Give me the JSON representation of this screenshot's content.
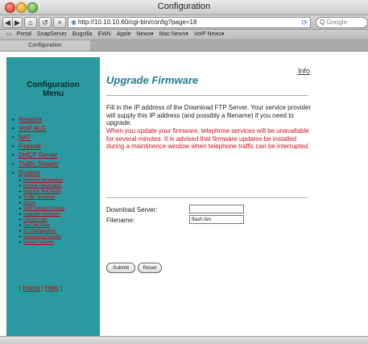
{
  "window": {
    "title": "Configuration"
  },
  "toolbar": {
    "back": "◀",
    "forward": "▶",
    "home": "⌂",
    "reload": "↺",
    "add": "+",
    "url": "http://10.10.10.60/cgi-bin/config?page=18",
    "search_placeholder": "Google"
  },
  "bookmarks": [
    "Portal",
    "SnapServer",
    "Bugzilla",
    "EWN",
    "Apple",
    "News▾",
    "Mac News▾",
    "VoIP News▾"
  ],
  "tab": {
    "label": "Configuration"
  },
  "sidebar": {
    "title_line1": "Configuration",
    "title_line2": "Menu",
    "items": [
      "Network",
      "VoIP ALG",
      "NAT",
      "Firewall",
      "DHCP Server",
      "Traffic Shaper",
      "System"
    ],
    "subitems": [
      "Network Information",
      "System Information",
      "Network Test Tools",
      "Traffic Simulator",
      "Route",
      "VoIP Subnet Routing",
      "Upgrade Firmware",
      "Clients Lists",
      "Set Link Rate",
      "T1 Configuration",
      "Networking Restart",
      "Reboot System"
    ],
    "bottom_links": {
      "home": "Home",
      "help": "Help"
    }
  },
  "main": {
    "info_link": "Info",
    "heading": "Upgrade Firmware",
    "intro": "Fill in the IP address of the Download FTP Server. Your service provider will supply this IP address (and possibly a filename) if you need to upgrade.",
    "warning": "When you update your firmware, telephone services will be unavailable for several minutes. It is advised that firmware updates be installed during a maintinence window when telephone traffic can be interrupted.",
    "form": {
      "server_label": "Download Server:",
      "server_value": "",
      "filename_label": "Filename:",
      "filename_value": "flash.bin"
    },
    "buttons": {
      "submit": "Submit",
      "reset": "Reset"
    }
  },
  "colors": {
    "sidebar_bg": "#2a9aa0",
    "link": "#c8000a",
    "heading": "#1d7d93",
    "warning": "#d0101a"
  }
}
